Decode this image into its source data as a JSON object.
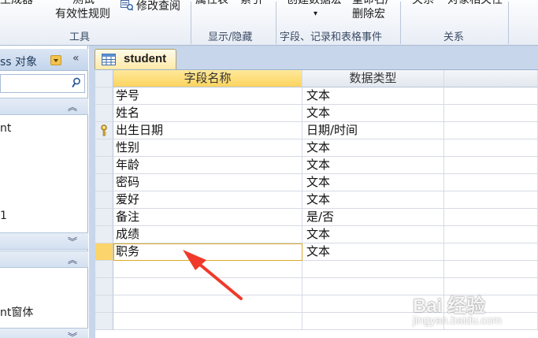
{
  "ribbon": {
    "buttons": [
      {
        "name": "generator-button",
        "label": "生成器"
      },
      {
        "name": "test-rules-button-top",
        "label": "测试"
      },
      {
        "name": "test-rules-button",
        "label": "有效性规则"
      },
      {
        "name": "modify-lookups-button",
        "label": "修改查阅"
      },
      {
        "name": "property-sheet-button",
        "label": "属性表"
      },
      {
        "name": "indexes-button",
        "label": "索引"
      },
      {
        "name": "create-data-macros-button",
        "label": "创建数据宏"
      },
      {
        "name": "rename-macro-button-top",
        "label": "重命名/"
      },
      {
        "name": "rename-delete-macro-button",
        "label": "删除宏"
      },
      {
        "name": "relationships-button",
        "label": "关系"
      },
      {
        "name": "object-dependencies-button",
        "label": "对象相关性"
      }
    ],
    "create_macro_arrow": "▾",
    "groups": [
      "工具",
      "显示/隐藏",
      "字段、记录和表格事件",
      "关系"
    ]
  },
  "nav": {
    "title": "ss 对象",
    "collapse_glyph": "«",
    "search_placeholder": "",
    "sections": [
      {
        "chevron": "︽"
      },
      {
        "chevron": "︾"
      },
      {
        "chevron": "︽"
      },
      {
        "chevron": "︾"
      }
    ],
    "items": [
      "nt",
      "1",
      "nt窗体"
    ]
  },
  "document": {
    "tab_label": "student",
    "columns": [
      "字段名称",
      "数据类型"
    ],
    "rows": [
      {
        "field": "学号",
        "type": "文本"
      },
      {
        "field": "姓名",
        "type": "文本"
      },
      {
        "field": "出生日期",
        "type": "日期/时间",
        "primary_key": true
      },
      {
        "field": "性别",
        "type": "文本"
      },
      {
        "field": "年龄",
        "type": "文本"
      },
      {
        "field": "密码",
        "type": "文本"
      },
      {
        "field": "爱好",
        "type": "文本"
      },
      {
        "field": "备注",
        "type": "是/否"
      },
      {
        "field": "成绩",
        "type": "文本"
      },
      {
        "field": "职务",
        "type": "文本",
        "active": true
      }
    ]
  },
  "watermark": {
    "main": "Bai 经验",
    "sub": "jingyan.baidu.com"
  },
  "colors": {
    "accent": "#fbd35f",
    "arrow": "#f0392b",
    "ribbon_bg": "#e8edf5",
    "nav_header": "#c4d5eb"
  }
}
